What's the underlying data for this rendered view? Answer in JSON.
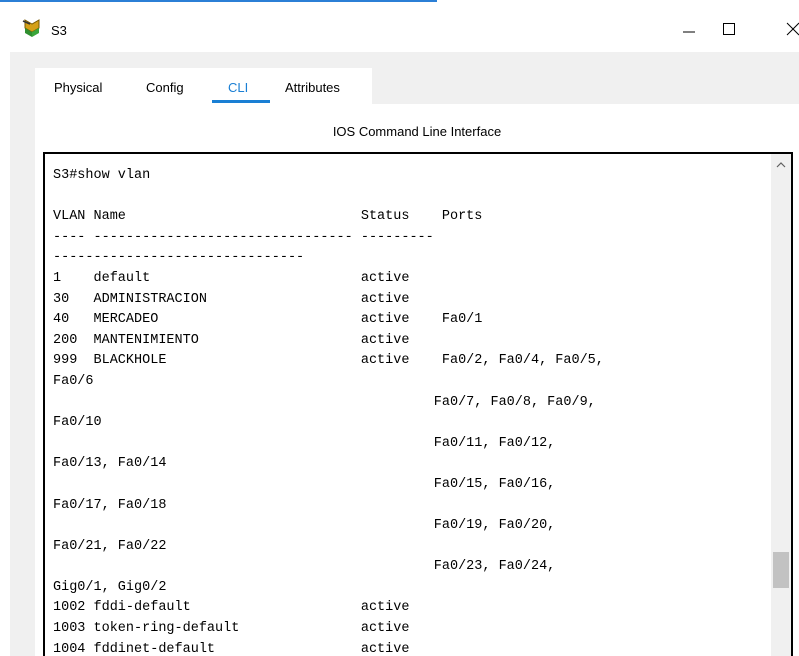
{
  "window": {
    "title": "S3",
    "icon": "switch-network-icon",
    "controls": {
      "minimize": "—",
      "maximize": "☐",
      "close": "✕"
    }
  },
  "tabs": [
    {
      "label": "Physical",
      "active": false
    },
    {
      "label": "Config",
      "active": false
    },
    {
      "label": "CLI",
      "active": true
    },
    {
      "label": "Attributes",
      "active": false
    }
  ],
  "panel": {
    "title": "IOS Command Line Interface"
  },
  "terminal": {
    "lines": [
      "S3#show vlan",
      "",
      "VLAN Name                             Status    Ports",
      "---- -------------------------------- ---------",
      "-------------------------------",
      "1    default                          active",
      "30   ADMINISTRACION                   active",
      "40   MERCADEO                         active    Fa0/1",
      "200  MANTENIMIENTO                    active",
      "999  BLACKHOLE                        active    Fa0/2, Fa0/4, Fa0/5,",
      "Fa0/6",
      "                                               Fa0/7, Fa0/8, Fa0/9,",
      "Fa0/10",
      "                                               Fa0/11, Fa0/12,",
      "Fa0/13, Fa0/14",
      "                                               Fa0/15, Fa0/16,",
      "Fa0/17, Fa0/18",
      "                                               Fa0/19, Fa0/20,",
      "Fa0/21, Fa0/22",
      "                                               Fa0/23, Fa0/24,",
      "Gig0/1, Gig0/2",
      "1002 fddi-default                     active",
      "1003 token-ring-default               active",
      "1004 fddinet-default                  active"
    ]
  },
  "colors": {
    "accent": "#1a7fd4",
    "tabs_background": "#f0f0f0"
  }
}
